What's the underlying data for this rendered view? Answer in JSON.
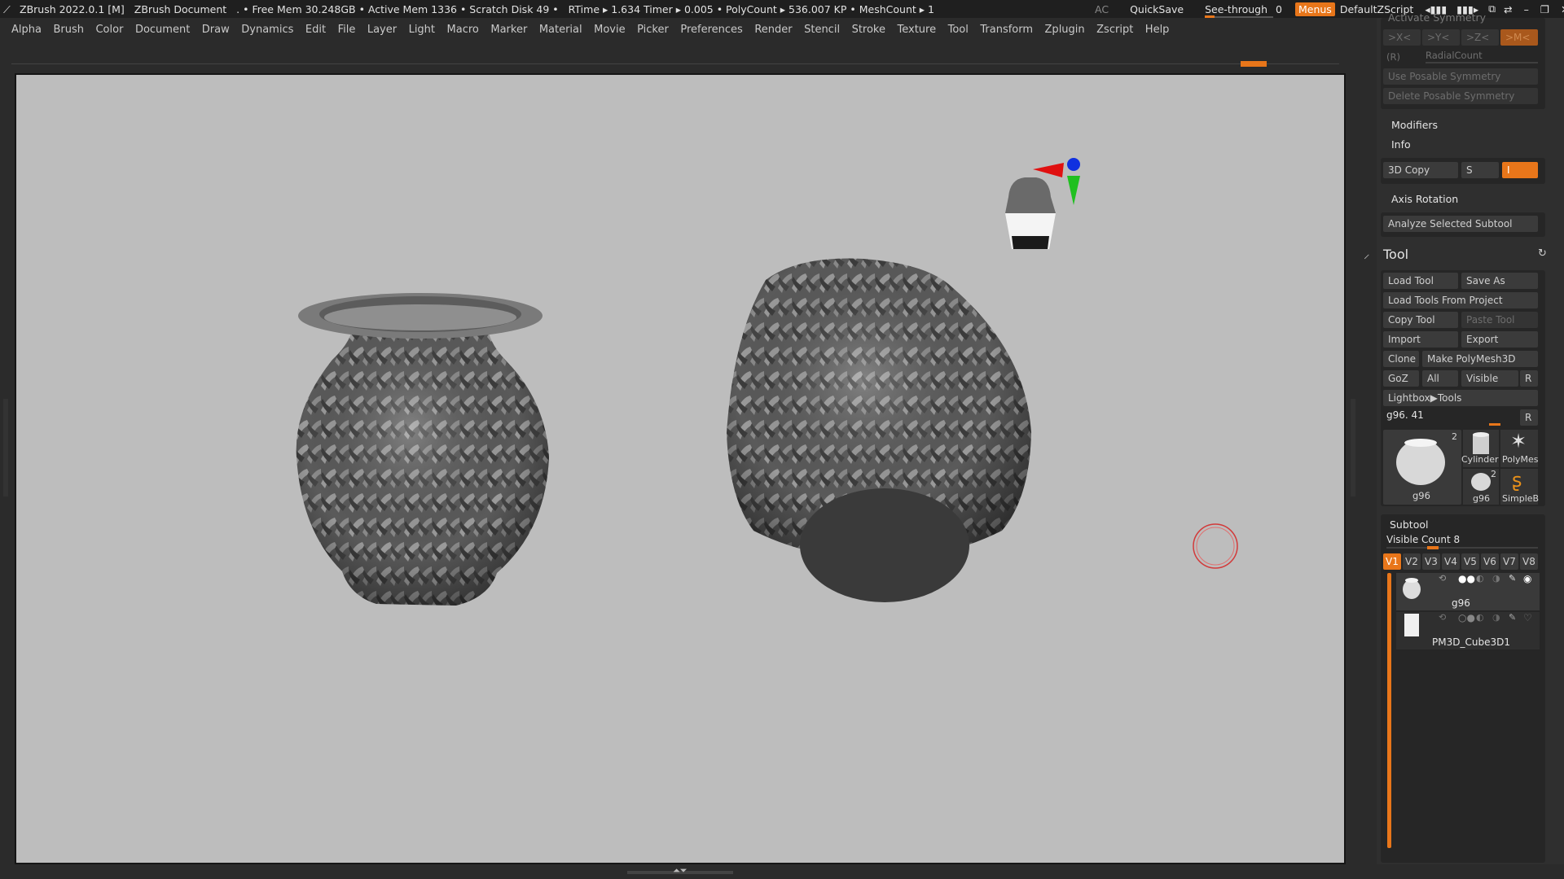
{
  "titlebar": {
    "app": "ZBrush 2022.0.1 [M]",
    "document": "ZBrush Document",
    "stats": ". • Free Mem 30.248GB • Active Mem 1336 • Scratch Disk 49 •",
    "timers": "RTime ▸ 1.634 Timer ▸ 0.005 • PolyCount ▸ 536.007 KP • MeshCount ▸ 1",
    "ac": "AC",
    "quicksave": "QuickSave",
    "see_through": "See-through",
    "see_through_value": "0",
    "menus": "Menus",
    "script": "DefaultZScript"
  },
  "menubar": [
    "Alpha",
    "Brush",
    "Color",
    "Document",
    "Draw",
    "Dynamics",
    "Edit",
    "File",
    "Layer",
    "Light",
    "Macro",
    "Marker",
    "Material",
    "Movie",
    "Picker",
    "Preferences",
    "Render",
    "Stencil",
    "Stroke",
    "Texture",
    "Tool",
    "Transform",
    "Zplugin",
    "Zscript",
    "Help"
  ],
  "symmetry": {
    "header": "Activate Symmetry",
    "x": ">X<",
    "y": ">Y<",
    "z": ">Z<",
    "m": ">M<",
    "r": "(R)",
    "radial": "RadialCount",
    "use_posable": "Use Posable Symmetry",
    "delete_posable": "Delete Posable Symmetry"
  },
  "geometry_sub": {
    "modifiers": "Modifiers",
    "info": "Info",
    "copy3d": "3D Copy",
    "s": "S",
    "i": "I",
    "axis_rotation": "Axis Rotation",
    "analyze": "Analyze Selected Subtool"
  },
  "tool": {
    "title": "Tool",
    "load_tool": "Load Tool",
    "save_as": "Save As",
    "load_from_project": "Load Tools From Project",
    "copy_tool": "Copy Tool",
    "paste_tool": "Paste Tool",
    "import": "Import",
    "export": "Export",
    "clone": "Clone",
    "make_polymesh": "Make PolyMesh3D",
    "goz": "GoZ",
    "all": "All",
    "visible": "Visible",
    "r": "R",
    "lightbox": "Lightbox▶Tools",
    "current": "g96. 41",
    "current_r": "R",
    "thumbs": [
      {
        "label": "g96",
        "badge": "2"
      },
      {
        "label": "Cylinder",
        "badge": ""
      },
      {
        "label": "PolyMes",
        "badge": ""
      },
      {
        "label": "g96",
        "badge": "2"
      },
      {
        "label": "SimpleB",
        "badge": ""
      }
    ]
  },
  "subtool": {
    "title": "Subtool",
    "visible_count": "Visible Count 8",
    "tabs": [
      "V1",
      "V2",
      "V3",
      "V4",
      "V5",
      "V6",
      "V7",
      "V8"
    ],
    "items": [
      {
        "name": "g96"
      },
      {
        "name": "PM3D_Cube3D1"
      }
    ]
  },
  "colors": {
    "accent": "#e8761a",
    "canvas": "#bdbdbd",
    "panel": "#2f2f2f",
    "titlebar": "#1f1f1f"
  }
}
